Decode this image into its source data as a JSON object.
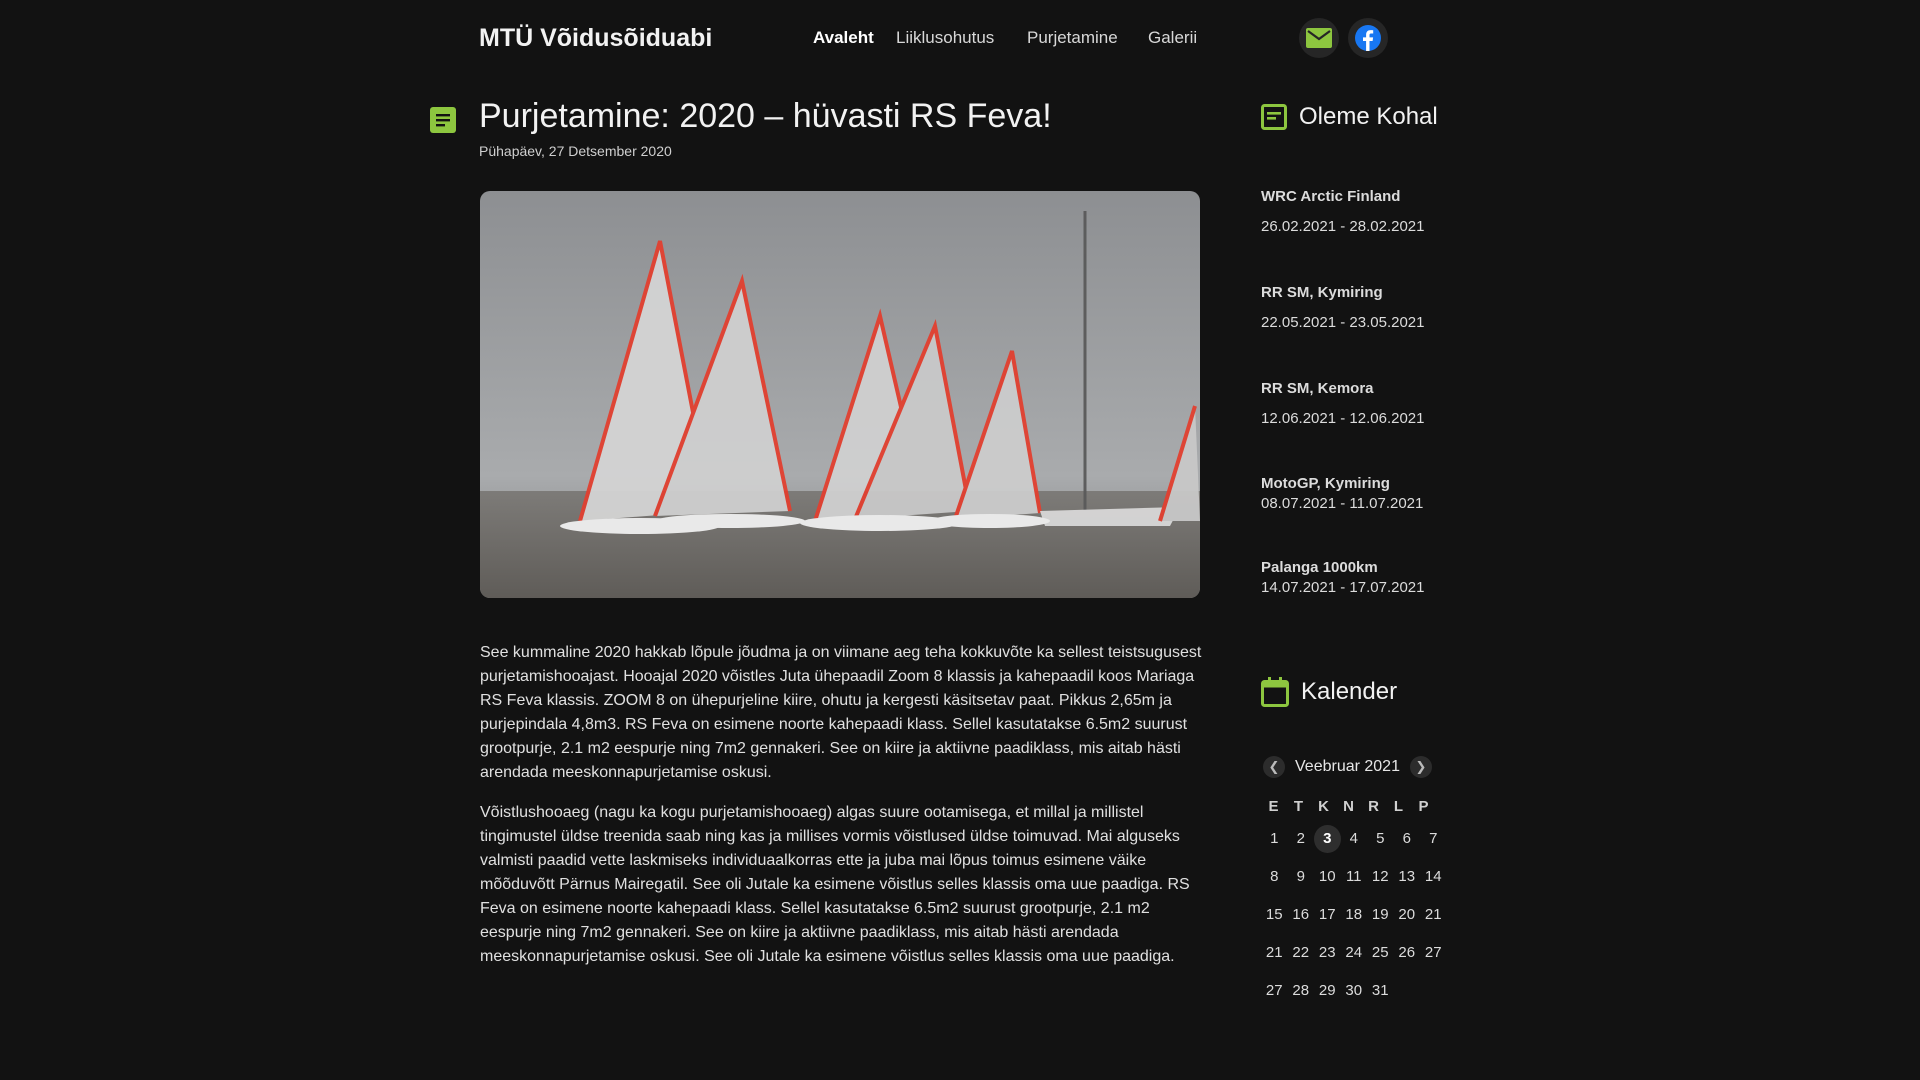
{
  "header": {
    "brand": "MTÜ Võidusõiduabi",
    "nav": [
      "Avaleht",
      "Liiklusohutus",
      "Purjetamine",
      "Galerii"
    ],
    "social": {
      "mail_icon": "mail-icon",
      "facebook_icon": "facebook-icon"
    }
  },
  "post": {
    "title": "Purjetamine: 2020 – hüvasti RS Feva!",
    "date": "Pühapäev, 27 Detsember 2020",
    "paragraphs": [
      "See kummaline 2020 hakkab lõpule jõudma ja on viimane aeg teha kokkuvõte ka sellest teistsugusest purjetamishooajast. Hooajal 2020 võistles Juta ühepaadil Zoom 8 klassis ja kahepaadil koos Mariaga RS Feva klassis. ZOOM 8 on ühepurjeline kiire, ohutu ja kergesti käsitsetav paat. Pikkus 2,65m ja purjepindala 4,8m3. RS Feva on esimene noorte kahepaadi klass.  Sellel kasutatakse 6.5m2 suurust grootpurje, 2.1 m2 eespurje ning 7m2 gennakeri. See on kiire ja aktiivne paadiklass, mis aitab hästi arendada meeskonnapurjetamise oskusi.",
      "Võistlushooaeg (nagu ka kogu purjetamishooaeg) algas suure ootamisega, et millal ja millistel tingimustel üldse treenida saab ning kas ja millises vormis võistlused üldse toimuvad. Mai alguseks valmisti paadid vette laskmiseks individuaalkorras ette ja juba mai lõpus toimus esimene väike mõõduvõtt Pärnus Mairegatil. See oli Jutale ka esimene võistlus selles klassis oma uue paadiga. RS Feva on esimene noorte kahepaadi klass.  Sellel kasutatakse 6.5m2 suurust grootpurje, 2.1 m2 eespurje ning 7m2 gennakeri. See on kiire ja aktiivne paadiklass, mis aitab hästi arendada meeskonnapurjetamise oskusi. See oli Jutale ka esimene võistlus selles klassis oma uue paadiga."
    ]
  },
  "sidebar": {
    "events_title": "Oleme Kohal",
    "events": [
      {
        "name": "WRC Arctic Finland",
        "dates": "26.02.2021 - 28.02.2021"
      },
      {
        "name": "RR SM, Kymiring",
        "dates": "22.05.2021 - 23.05.2021"
      },
      {
        "name": "RR SM, Kemora",
        "dates": "12.06.2021 - 12.06.2021"
      },
      {
        "name": "MotoGP, Kymiring",
        "dates": "08.07.2021 - 11.07.2021"
      },
      {
        "name": "Palanga 1000km",
        "dates": "14.07.2021 - 17.07.2021"
      }
    ],
    "calendar_title": "Kalender",
    "calendar": {
      "month": "Veebruar 2021",
      "weekdays": [
        "E",
        "T",
        "K",
        "N",
        "R",
        "L",
        "P"
      ],
      "weeks": [
        [
          "1",
          "2",
          "3",
          "4",
          "5",
          "6",
          "7"
        ],
        [
          "8",
          "9",
          "10",
          "11",
          "12",
          "13",
          "14"
        ],
        [
          "15",
          "16",
          "17",
          "18",
          "19",
          "20",
          "21"
        ],
        [
          "21",
          "22",
          "23",
          "24",
          "25",
          "26",
          "27"
        ],
        [
          "27",
          "28",
          "29",
          "30",
          "31"
        ]
      ],
      "today": "3"
    }
  },
  "colors": {
    "accent": "#8dc63f",
    "background": "#121212",
    "facebook": "#1877f2"
  }
}
